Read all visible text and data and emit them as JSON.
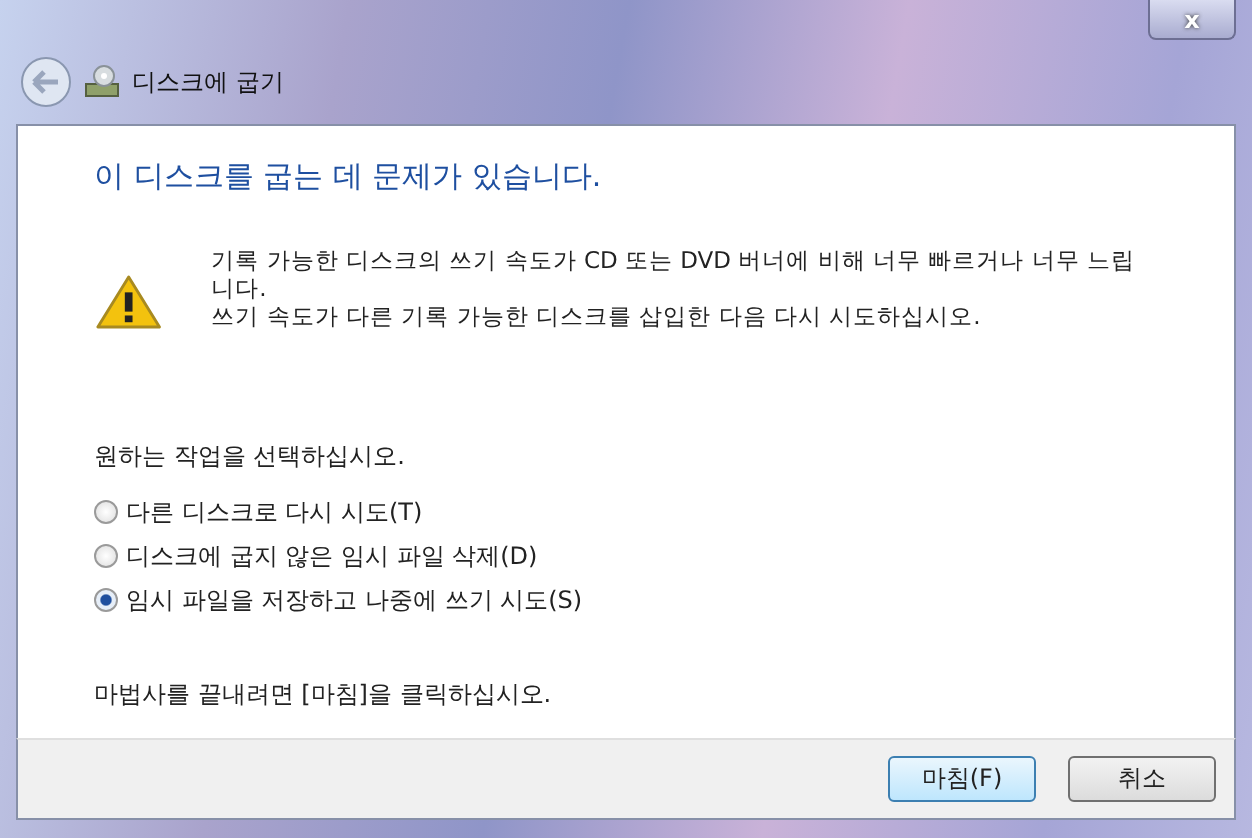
{
  "window": {
    "title": "디스크에 굽기",
    "close": "x"
  },
  "heading": "이 디스크를 굽는 데 문제가 있습니다.",
  "message": [
    "기록 가능한 디스크의 쓰기 속도가 CD 또는 DVD 버너에 비해 너무 빠르거나 너무 느립니다.",
    "쓰기 속도가 다른 기록 가능한 디스크를 삽입한 다음 다시 시도하십시오."
  ],
  "prompt": "원하는 작업을 선택하십시오.",
  "options": [
    {
      "label": "다른 디스크로 다시 시도(T)",
      "selected": false
    },
    {
      "label": "디스크에 굽지 않은 임시 파일 삭제(D)",
      "selected": false
    },
    {
      "label": "임시 파일을 저장하고 나중에 쓰기 시도(S)",
      "selected": true
    }
  ],
  "note": "마법사를 끝내려면 [마침]을 클릭하십시오.",
  "buttons": [
    {
      "label": "마침(F)",
      "kind": "default"
    },
    {
      "label": "취소",
      "kind": "normal"
    }
  ]
}
